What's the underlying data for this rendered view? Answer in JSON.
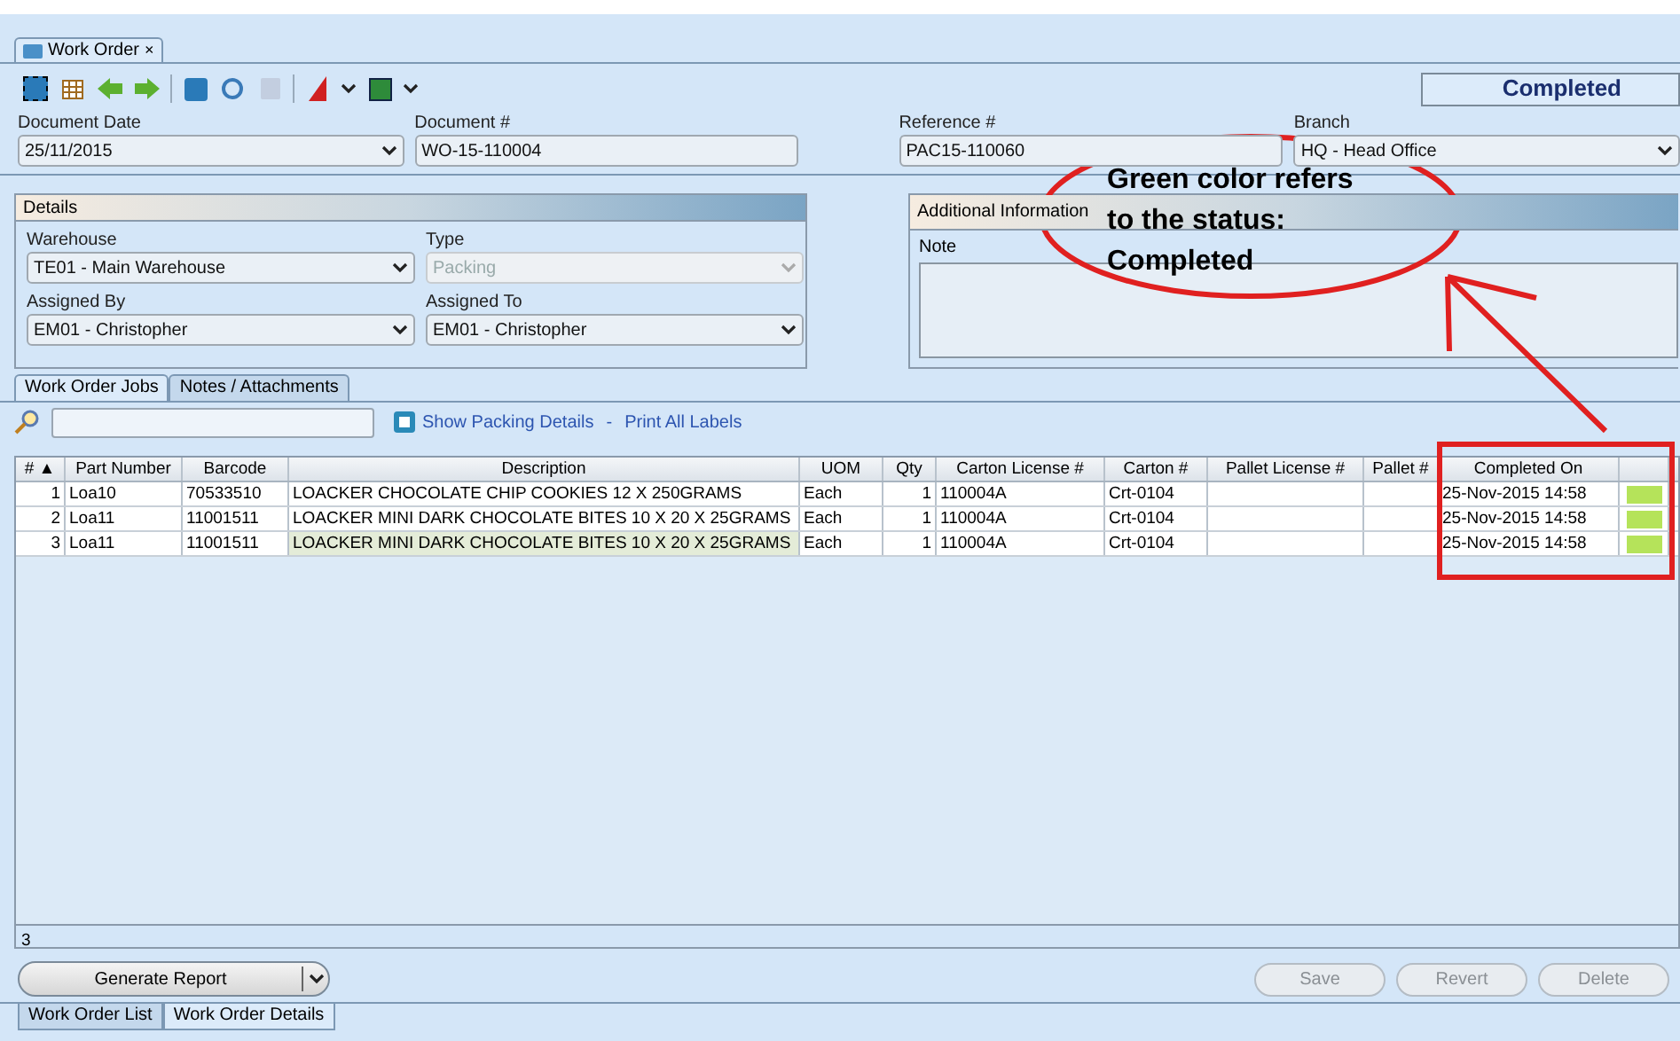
{
  "window_tab": {
    "label": "Work Order",
    "close": "×"
  },
  "status": "Completed",
  "header": {
    "fields": [
      {
        "label": "Document Date",
        "value": "25/11/2015",
        "kind": "dropdown"
      },
      {
        "label": "Document #",
        "value": "WO-15-110004",
        "kind": "text"
      },
      {
        "label": "Reference #",
        "value": "PAC15-110060",
        "kind": "text"
      },
      {
        "label": "Branch",
        "value": "HQ - Head Office",
        "kind": "dropdown"
      }
    ]
  },
  "details": {
    "title": "Details",
    "fields": [
      {
        "label": "Warehouse",
        "value": "TE01 - Main Warehouse",
        "disabled": false
      },
      {
        "label": "Type",
        "value": "Packing",
        "disabled": true
      },
      {
        "label": "Assigned By",
        "value": "EM01 - Christopher",
        "disabled": false
      },
      {
        "label": "Assigned To",
        "value": "EM01 - Christopher",
        "disabled": false
      }
    ]
  },
  "additional": {
    "title": "Additional Information",
    "note_label": "Note"
  },
  "tabs": [
    {
      "label": "Work Order Jobs",
      "selected": true
    },
    {
      "label": "Notes / Attachments",
      "selected": false
    }
  ],
  "links": [
    "Show Packing Details",
    "-",
    "Print All Labels"
  ],
  "table": {
    "columns": [
      "# ▲",
      "Part Number",
      "Barcode",
      "Description",
      "UOM",
      "Qty",
      "Carton License #",
      "Carton #",
      "Pallet License #",
      "Pallet #",
      "Completed On"
    ],
    "rows": [
      {
        "cells": [
          "1",
          "Loa10",
          "70533510",
          "LOACKER CHOCOLATE CHIP COOKIES 12 X 250GRAMS",
          "Each",
          "1",
          "110004A",
          "Crt-0104",
          "",
          "",
          "25-Nov-2015 14:58"
        ],
        "color": "#b5e35a",
        "selected": false
      },
      {
        "cells": [
          "2",
          "Loa11",
          "11001511",
          "LOACKER MINI DARK CHOCOLATE BITES 10 X 20 X 25GRAMS",
          "Each",
          "1",
          "110004A",
          "Crt-0104",
          "",
          "",
          "25-Nov-2015 14:58"
        ],
        "color": "#b5e35a",
        "selected": false
      },
      {
        "cells": [
          "3",
          "Loa11",
          "11001511",
          "LOACKER MINI DARK CHOCOLATE BITES 10 X 20 X 25GRAMS",
          "Each",
          "1",
          "110004A",
          "Crt-0104",
          "",
          "",
          "25-Nov-2015 14:58"
        ],
        "color": "#b5e35a",
        "selected": true
      }
    ],
    "count": "3"
  },
  "report_button": "Generate Report",
  "actions": [
    {
      "label": "Save",
      "disabled": true
    },
    {
      "label": "Revert",
      "disabled": true
    },
    {
      "label": "Delete",
      "disabled": true
    }
  ],
  "bottom_tabs": [
    {
      "label": "Work Order List",
      "selected": false
    },
    {
      "label": "Work Order Details",
      "selected": true
    }
  ],
  "annotation": {
    "lines": [
      "Green color refers",
      "to the status:",
      "Completed"
    ]
  }
}
